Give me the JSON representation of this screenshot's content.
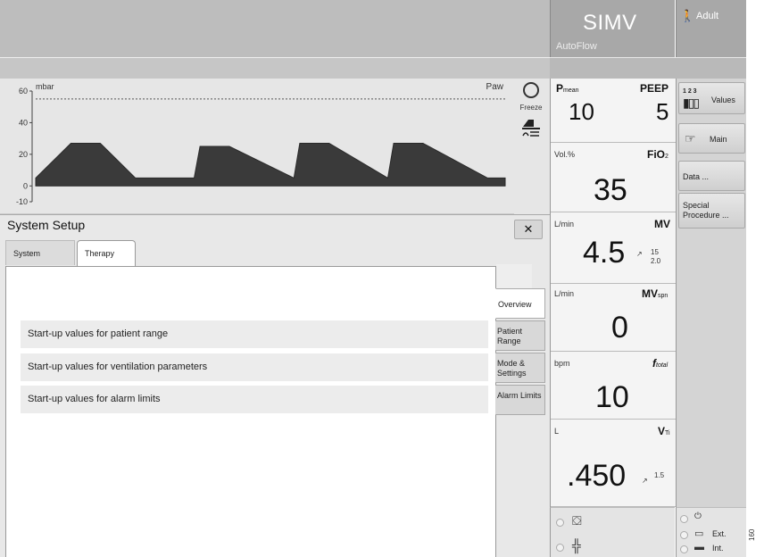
{
  "header": {
    "mode_title": "SIMV",
    "mode_subtitle": "AutoFlow",
    "patient_category": "Adult",
    "patient_icon": "adult-person-icon"
  },
  "waveform": {
    "unit": "mbar",
    "parameter": "Paw",
    "y_ticks": [
      "60",
      "40",
      "20",
      "0",
      "-10"
    ],
    "freeze_label": "Freeze",
    "freeze_icon": "freeze-circle-icon",
    "scale_icon": "waveform-scale-icon"
  },
  "monitoring": {
    "pmean": {
      "label": "P",
      "label_sub": "mean",
      "value": "10"
    },
    "peep": {
      "label": "PEEP",
      "value": "5"
    },
    "fio2": {
      "unit": "Vol.%",
      "label": "FiO",
      "label_sub": "2",
      "value": "35"
    },
    "mv": {
      "unit": "L/min",
      "label": "MV",
      "value": "4.5",
      "alarm_high": "15",
      "alarm_low": "2.0"
    },
    "mvspn": {
      "unit": "L/min",
      "label": "MV",
      "label_sub": "spn",
      "value": "0"
    },
    "ftotal": {
      "unit": "bpm",
      "label": "f",
      "label_sub": "total",
      "value": "10"
    },
    "vti": {
      "unit": "L",
      "label": "V",
      "label_sub": "Ti",
      "value": ".450",
      "alarm_high": "1.5"
    }
  },
  "side_buttons": {
    "values": "Values",
    "values_icon_digits": "1 2 3",
    "main": "Main",
    "data": "Data ...",
    "special_procedure": "Special Procedure ..."
  },
  "status": {
    "battery_ext": "Ext.",
    "battery_int": "Int."
  },
  "dialog": {
    "title": "System Setup",
    "close": "✕",
    "tabs": [
      "System",
      "Therapy"
    ],
    "active_tab": "Therapy",
    "rows": [
      "Start-up values for patient range",
      "Start-up values for ventilation parameters",
      "Start-up values for alarm limits"
    ],
    "vertical_tabs": [
      "Overview",
      "Patient Range",
      "Mode & Settings",
      "Alarm Limits"
    ]
  },
  "figure_number": "160",
  "chart_data": {
    "type": "area",
    "title": "",
    "ylabel": "mbar",
    "series_label": "Paw",
    "y_ticks": [
      60,
      40,
      20,
      0,
      -10
    ],
    "ylim": [
      -10,
      60
    ],
    "reference_line": 55,
    "series": [
      {
        "name": "Paw",
        "x": [
          0,
          0.6,
          1.1,
          1.7,
          2.7,
          2.8,
          3.3,
          4.4,
          4.5,
          5.0,
          6.0,
          6.1,
          6.6,
          7.7,
          8.0
        ],
        "values": [
          5,
          27,
          27,
          5,
          5,
          25,
          25,
          5,
          27,
          27,
          5,
          27,
          27,
          5,
          5
        ]
      }
    ]
  }
}
